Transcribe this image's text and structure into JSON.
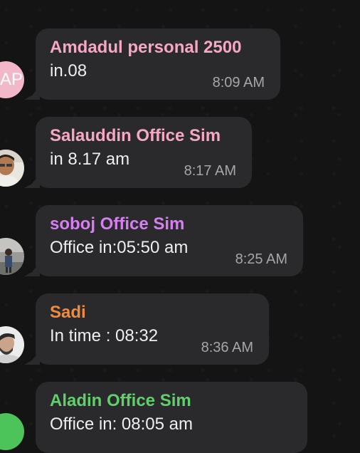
{
  "messages": [
    {
      "sender": "Amdadul personal 2500",
      "sender_color": "#f7a6c5",
      "text": "in.08",
      "time": "8:09 AM",
      "avatar": {
        "type": "initials",
        "initials": "AP",
        "color": "#f2b8c9"
      }
    },
    {
      "sender": "Salauddin Office Sim",
      "sender_color": "#f7a6c5",
      "text": "in 8.17 am",
      "time": "8:17 AM",
      "avatar": {
        "type": "photo",
        "description": "profile-photo"
      }
    },
    {
      "sender": "soboj Office Sim",
      "sender_color": "#d77ef5",
      "text": "Office in:05:50 am",
      "time": "8:25 AM",
      "avatar": {
        "type": "photo",
        "description": "profile-photo"
      }
    },
    {
      "sender": "Sadi",
      "sender_color": "#f28a3c",
      "text": "In time : 08:32",
      "time": "8:36 AM",
      "avatar": {
        "type": "photo",
        "description": "profile-photo"
      }
    },
    {
      "sender": "Aladin Office Sim",
      "sender_color": "#5fd16a",
      "text": "Office in: 08:05 am",
      "time": "",
      "avatar": {
        "type": "initials",
        "initials": "",
        "color": "#4cc45a"
      }
    }
  ]
}
